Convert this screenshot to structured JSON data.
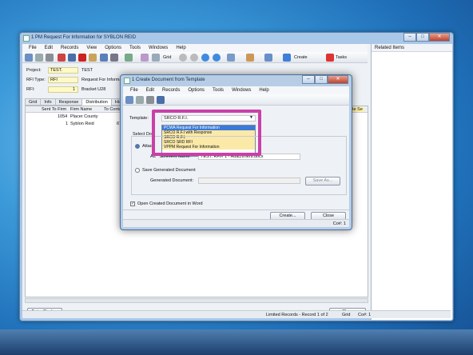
{
  "main_window": {
    "title": "1 PM Request For Information for SYBLON REID",
    "menu": [
      "File",
      "Edit",
      "Records",
      "View",
      "Options",
      "Tools",
      "Windows",
      "Help"
    ],
    "toolbar": {
      "grid_label": "Grid",
      "create_label": "Create",
      "tasks_label": "Tasks"
    },
    "related_items_title": "Related Items",
    "project_label": "Project:",
    "project_code": "TEST.",
    "project_name": "TEST",
    "rfi_type_label": "RFI Type:",
    "rfi_type_value": "RFI",
    "rfi_type_desc": "Request For Informat",
    "rfi_label": "RFI:",
    "rfi_number": "1",
    "rfi_subject": "Bracket U28",
    "tabs": [
      "Grid",
      "Info",
      "Response",
      "Distribution",
      "Histo"
    ],
    "grid_headers": [
      "Sent To Firm",
      "Firm Name",
      "To Contact"
    ],
    "grid_rows": [
      {
        "firm": "1054",
        "name": "Placer County",
        "contact": "4"
      },
      {
        "firm": "1",
        "name": "Syblon Reid",
        "contact": "677"
      }
    ],
    "right_header_fragment": "ate Se",
    "enter_reply_button": "Enter Reply...",
    "close_button": "Close",
    "status_records": "Limited Records - Record 1 of 2",
    "status_grid": "Grid",
    "status_co": "Co#: 1"
  },
  "dialog": {
    "title": "1 Create Document from Template",
    "menu": [
      "File",
      "Edit",
      "Records",
      "Options",
      "Tools",
      "Windows",
      "Help"
    ],
    "template_label": "Template:",
    "template_value": "SRCO R.F.I.",
    "template_options": [
      "PCWA Request For Information",
      "SRCO R.F.I with Response",
      "SRCO R.F.I.",
      "SRCO SRD RFI",
      "VPPM Request For Information"
    ],
    "select_doc_label": "Select Doc",
    "attach_label": "Attac",
    "attachment_name_label": "Att",
    "attachment_name_suffix": "achment Name:",
    "attachment_name_value": "TEST. RFI# 1 - Attachment.docx",
    "save_generated_label": "Save Generated Document",
    "generated_document_label": "Generated Document:",
    "save_as_button": "Save As...",
    "open_in_word_label": "Open Created Document in Word",
    "create_button": "Create...",
    "close_button": "Close",
    "status_co": "Co#: 1"
  }
}
